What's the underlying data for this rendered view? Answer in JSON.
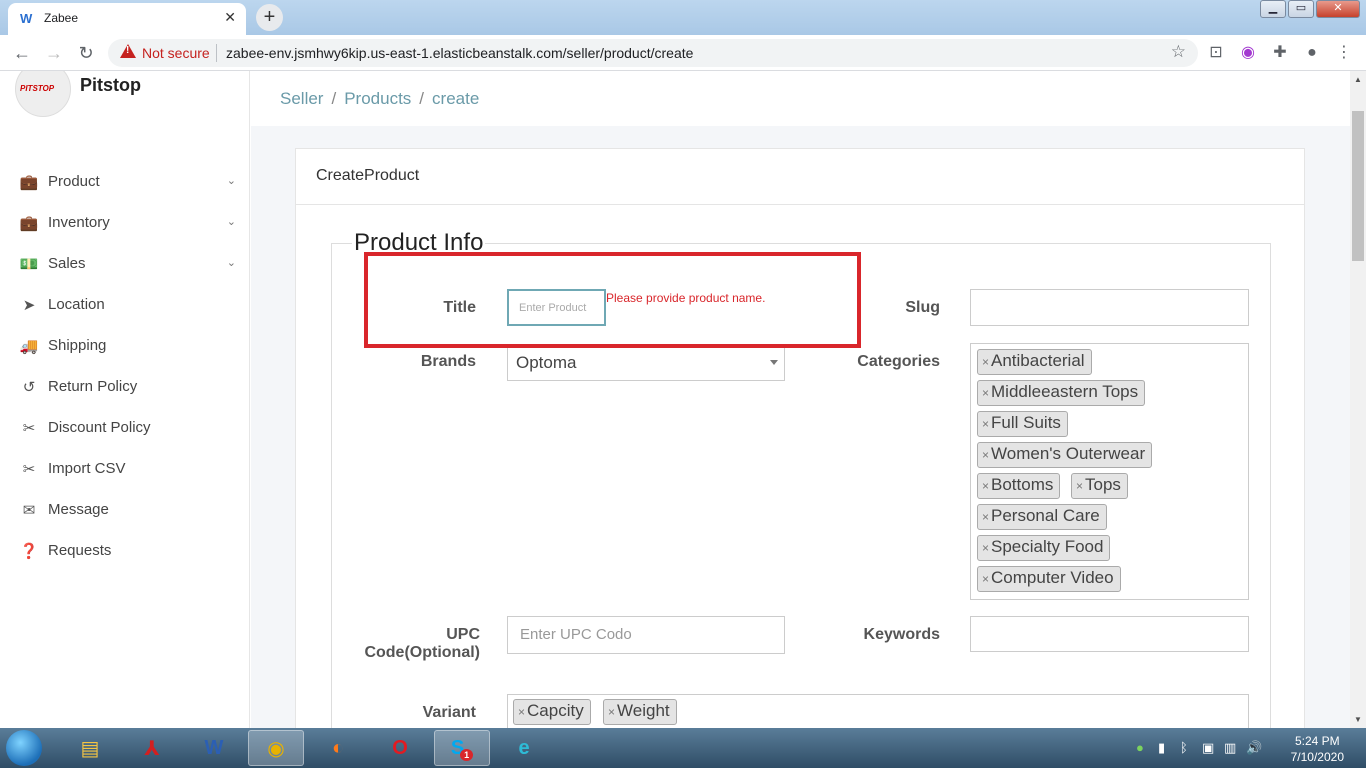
{
  "browser": {
    "tab_title": "Zabee",
    "tab_favicon": "zabee-favicon",
    "new_tab": "+",
    "security_label": "Not secure",
    "url": "zabee-env.jsmhwy6kip.us-east-1.elasticbeanstalk.com/seller/product/create"
  },
  "sidebar": {
    "brand": "Pitstop",
    "logo_text": "PITSTOP",
    "items": [
      {
        "label": "Product",
        "icon": "briefcase-icon",
        "expandable": true
      },
      {
        "label": "Inventory",
        "icon": "briefcase-icon",
        "expandable": true
      },
      {
        "label": "Sales",
        "icon": "money-icon",
        "expandable": true
      },
      {
        "label": "Location",
        "icon": "location-arrow-icon",
        "expandable": false
      },
      {
        "label": "Shipping",
        "icon": "truck-icon",
        "expandable": false
      },
      {
        "label": "Return Policy",
        "icon": "undo-icon",
        "expandable": false
      },
      {
        "label": "Discount Policy",
        "icon": "scissors-icon",
        "expandable": false
      },
      {
        "label": "Import CSV",
        "icon": "scissors-icon",
        "expandable": false
      },
      {
        "label": "Message",
        "icon": "envelope-icon",
        "expandable": false
      },
      {
        "label": "Requests",
        "icon": "question-circle-icon",
        "expandable": false
      }
    ]
  },
  "breadcrumb": {
    "items": [
      "Seller",
      "Products",
      "create"
    ],
    "separator": "/"
  },
  "card": {
    "title": "CreateProduct",
    "section": "Product Info"
  },
  "form": {
    "title_label": "Title",
    "title_placeholder": "Enter Product",
    "title_error": "Please provide product name.",
    "slug_label": "Slug",
    "slug_value": "",
    "brands_label": "Brands",
    "brands_value": "Optoma",
    "categories_label": "Categories",
    "categories": [
      "Antibacterial",
      "Middleeastern Tops",
      "Full Suits",
      "Women's Outerwear",
      "Bottoms",
      "Tops",
      "Personal Care",
      "Specialty Food",
      "Computer Video"
    ],
    "upc_label_1": "UPC",
    "upc_label_2": "Code(Optional)",
    "upc_placeholder": "Enter UPC Codo",
    "keywords_label": "Keywords",
    "keywords_value": "",
    "variant_label": "Variant",
    "variants": [
      "Capcity",
      "Weight"
    ],
    "tag_remove": "×"
  },
  "taskbar": {
    "apps": [
      "file-explorer-icon",
      "acrobat-icon",
      "word-icon",
      "chrome-icon",
      "firefox-icon",
      "opera-icon",
      "skype-icon",
      "edge-icon"
    ],
    "skype_badge": "1",
    "time": "5:24 PM",
    "date": "7/10/2020"
  },
  "colors": {
    "accent": "#6a9aa8",
    "error": "#d9262b",
    "highlight_box": "#d9262b"
  }
}
